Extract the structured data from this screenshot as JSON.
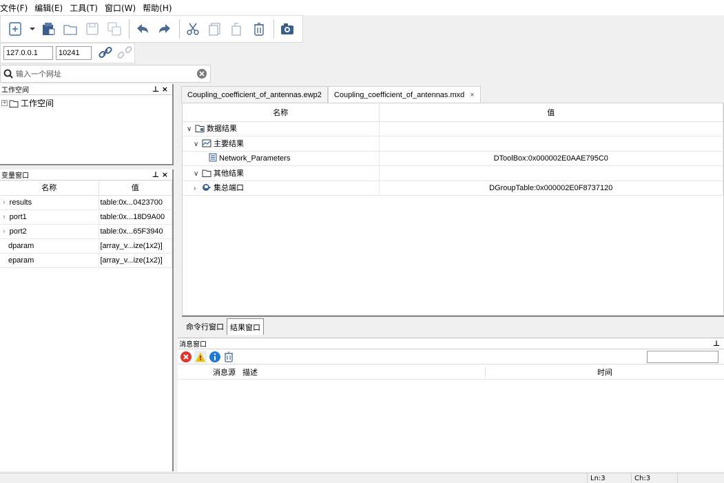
{
  "menubar": {
    "items": [
      "文件(F)",
      "编辑(E)",
      "工具(T)",
      "窗口(W)",
      "帮助(H)"
    ]
  },
  "toolbar": {
    "icons": [
      "new-file-icon",
      "dropdown-arrow-icon",
      "project-icon",
      "open-folder-icon",
      "save-icon",
      "save-all-icon",
      "undo-icon",
      "redo-icon",
      "cut-icon",
      "copy-icon",
      "paste-icon",
      "delete-icon",
      "screenshot-icon"
    ]
  },
  "connection": {
    "host": "127.0.0.1",
    "port": "10241"
  },
  "url_search": {
    "placeholder": "输入一个网址"
  },
  "workspace_panel": {
    "title": "工作空间",
    "pin": "⊥ ×",
    "tree_root": "工作空间"
  },
  "variable_panel": {
    "title": "变量窗口",
    "pin": "⊥ ×",
    "columns": [
      "名称",
      "值"
    ],
    "rows": [
      {
        "name": "results",
        "value": "table:0x...0423700",
        "expandable": true
      },
      {
        "name": "port1",
        "value": "table:0x...18D9A00",
        "expandable": true
      },
      {
        "name": "port2",
        "value": "table:0x...65F3940",
        "expandable": true
      },
      {
        "name": "dparam",
        "value": "[array_v...ize(1x2)]",
        "expandable": false
      },
      {
        "name": "eparam",
        "value": "[array_v...ize(1x2)]",
        "expandable": false
      }
    ]
  },
  "editor_tabs": [
    {
      "label": "Coupling_coefficient_of_antennas.ewp2",
      "active": false
    },
    {
      "label": "Coupling_coefficient_of_antennas.mxd",
      "active": true,
      "close": "×"
    }
  ],
  "result_table": {
    "columns": [
      "名称",
      "值"
    ],
    "rows": [
      {
        "level": 0,
        "arrow": "∨",
        "label": "数据结果",
        "value": ""
      },
      {
        "level": 1,
        "arrow": "∨",
        "label": "主要结果",
        "value": ""
      },
      {
        "level": 2,
        "arrow": "",
        "label": "Network_Parameters",
        "value": "DToolBox:0x000002E0AAE795C0"
      },
      {
        "level": 1,
        "arrow": "∨",
        "label": "其他结果",
        "value": ""
      },
      {
        "level": 1,
        "arrow": "›",
        "label": "集总端口",
        "value": "DGroupTable:0x000002E0F8737120"
      }
    ]
  },
  "bottom_tabs": [
    "命令行窗口",
    "结果窗口"
  ],
  "message_panel": {
    "title": "消息窗口",
    "pin": "⊥",
    "columns": [
      "消息源",
      "描述",
      "时间"
    ]
  },
  "statusbar": {
    "line": "Ln:3",
    "col": "Ch:3"
  },
  "colors": {
    "error": "#e5332a",
    "warning": "#f5c000",
    "info": "#1e7ad6",
    "border_dark": "#8a8a8a"
  }
}
